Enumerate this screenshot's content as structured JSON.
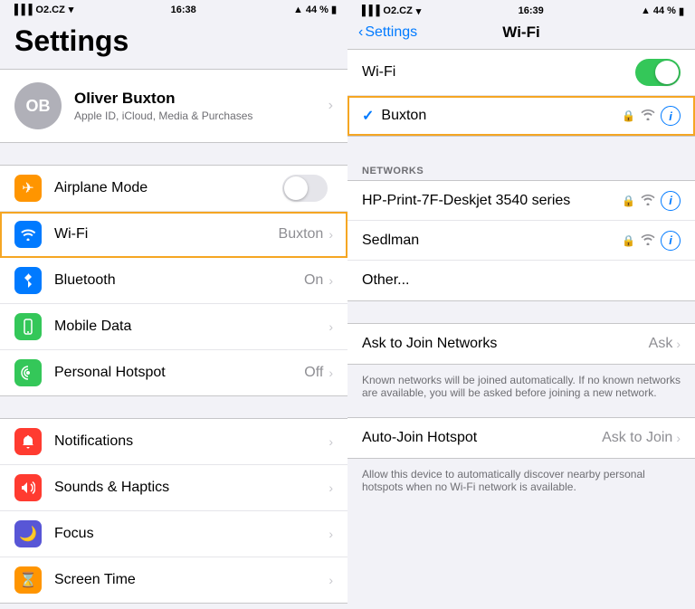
{
  "left": {
    "statusBar": {
      "carrier": "O2.CZ",
      "wifi": "📶",
      "time": "16:38",
      "battery": "44 %"
    },
    "title": "Settings",
    "profile": {
      "initials": "OB",
      "name": "Oliver Buxton",
      "subtitle": "Apple ID, iCloud, Media & Purchases"
    },
    "group1": [
      {
        "id": "airplane",
        "label": "Airplane Mode",
        "value": "",
        "showToggle": true
      },
      {
        "id": "wifi",
        "label": "Wi-Fi",
        "value": "Buxton",
        "highlighted": true
      },
      {
        "id": "bluetooth",
        "label": "Bluetooth",
        "value": "On"
      },
      {
        "id": "mobile",
        "label": "Mobile Data",
        "value": ""
      },
      {
        "id": "hotspot",
        "label": "Personal Hotspot",
        "value": "Off"
      }
    ],
    "group2": [
      {
        "id": "notifications",
        "label": "Notifications",
        "value": ""
      },
      {
        "id": "sounds",
        "label": "Sounds & Haptics",
        "value": ""
      },
      {
        "id": "focus",
        "label": "Focus",
        "value": ""
      },
      {
        "id": "screentime",
        "label": "Screen Time",
        "value": ""
      }
    ]
  },
  "right": {
    "statusBar": {
      "carrier": "O2.CZ",
      "time": "16:39",
      "battery": "44 %"
    },
    "nav": {
      "back": "Settings",
      "title": "Wi-Fi"
    },
    "wifiToggle": {
      "label": "Wi-Fi",
      "enabled": true
    },
    "connectedNetwork": {
      "name": "Buxton",
      "highlighted": true
    },
    "sectionHeader": "NETWORKS",
    "networks": [
      {
        "name": "HP-Print-7F-Deskjet 3540 series",
        "hasLock": true,
        "hasInfo": true
      },
      {
        "name": "Sedlman",
        "hasLock": true,
        "hasInfo": true
      },
      {
        "name": "Other...",
        "hasLock": false,
        "hasInfo": false
      }
    ],
    "askToJoin": {
      "label": "Ask to Join Networks",
      "value": "Ask",
      "description": "Known networks will be joined automatically. If no known networks are available, you will be asked before joining a new network."
    },
    "autoJoin": {
      "label": "Auto-Join Hotspot",
      "value": "Ask to Join",
      "description": "Allow this device to automatically discover nearby personal hotspots when no Wi-Fi network is available."
    }
  }
}
